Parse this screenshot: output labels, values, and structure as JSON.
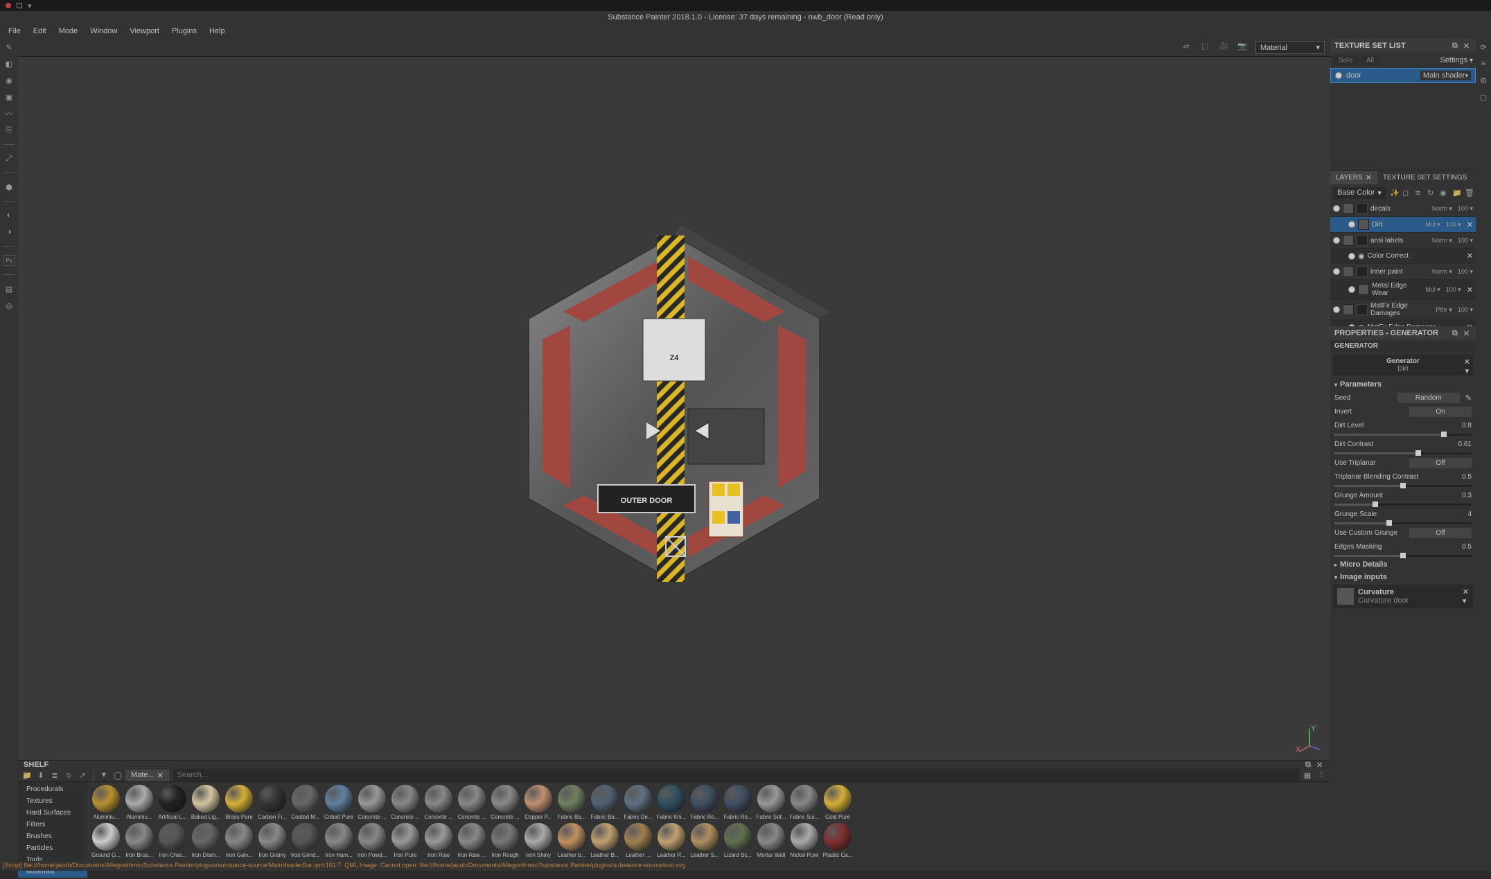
{
  "window": {
    "title": "Substance Painter 2018.1.0 - License: 37 days remaining - nwb_door (Read only)"
  },
  "menu": [
    "File",
    "Edit",
    "Mode",
    "Window",
    "Viewport",
    "Plugins",
    "Help"
  ],
  "viewport": {
    "material_dropdown": "Material",
    "model_label_top": "Z4",
    "model_label_bottom": "OUTER DOOR"
  },
  "texture_set": {
    "title": "TEXTURE SET LIST",
    "solo": "Solo",
    "all": "All",
    "settings": "Settings",
    "item": "door",
    "shader": "Main shader"
  },
  "layers_panel": {
    "tabs": [
      "LAYERS",
      "TEXTURE SET SETTINGS"
    ],
    "channel": "Base Color",
    "layers": [
      {
        "name": "decals",
        "blend": "Norm",
        "opacity": "100"
      },
      {
        "name": "Dirt",
        "blend": "Mul",
        "opacity": "100",
        "sub": true,
        "selected": true
      },
      {
        "name": "ansi labels",
        "blend": "Norm",
        "opacity": "100"
      },
      {
        "name": "Color Correct",
        "sub": true,
        "fx": true
      },
      {
        "name": "inner paint",
        "blend": "Norm",
        "opacity": "100"
      },
      {
        "name": "Metal Edge Wear",
        "blend": "Mul",
        "opacity": "100",
        "sub": true
      },
      {
        "name": "MatFx Edge Damages",
        "blend": "Pthr",
        "opacity": "100"
      },
      {
        "name": "MatFx Edge Damages",
        "sub": true,
        "fx": true
      }
    ]
  },
  "properties": {
    "title": "PROPERTIES - GENERATOR",
    "section": "GENERATOR",
    "gen_label": "Generator",
    "gen_name": "Dirt",
    "params_title": "Parameters",
    "params": [
      {
        "label": "Seed",
        "btn": "Random"
      },
      {
        "label": "Invert",
        "btn": "On"
      },
      {
        "label": "Dirt Level",
        "val": "0.8",
        "slider": 80
      },
      {
        "label": "Dirt Contrast",
        "val": "0.61",
        "slider": 61
      },
      {
        "label": "Use Triplanar",
        "btn": "Off"
      },
      {
        "label": "Triplanar Blending Contrast",
        "val": "0.5",
        "slider": 50
      },
      {
        "label": "Grunge Amount",
        "val": "0.3",
        "slider": 30
      },
      {
        "label": "Grunge Scale",
        "val": "4",
        "slider": 40
      },
      {
        "label": "Use Custom Grunge",
        "btn": "Off"
      },
      {
        "label": "Edges Masking",
        "val": "0.5",
        "slider": 50
      }
    ],
    "micro": "Micro Details",
    "image_inputs": "Image inputs",
    "curvature": "Curvature",
    "curvature_src": "Curvature door"
  },
  "shelf": {
    "title": "SHELF",
    "tab_label": "Mate...",
    "search_placeholder": "Search...",
    "categories": [
      "Procedurals",
      "Textures",
      "Hard Surfaces",
      "Filters",
      "Brushes",
      "Particles",
      "Tools",
      "Materials"
    ],
    "active_cat": "Materials",
    "row1": [
      "Aluminiu...",
      "Aluminiu...",
      "Artificial L...",
      "Baked Lig...",
      "Brass Pure",
      "Carbon Fi...",
      "Coated M...",
      "Cobalt Pure",
      "Concrete ...",
      "Concrete ...",
      "Concrete ...",
      "Concrete ...",
      "Concrete ...",
      "Copper P...",
      "Fabric Ba...",
      "Fabric Ba...",
      "Fabric De...",
      "Fabric Kni...",
      "Fabric Ro...",
      "Fabric Ro...",
      "Fabric Sof...",
      "Fabric Sui...",
      "Gold Pure"
    ],
    "row2": [
      "Ground G...",
      "Iron Brus...",
      "Iron Chai...",
      "Iron Diam...",
      "Iron Galv...",
      "Iron Grainy",
      "Iron Grind...",
      "Iron Ham...",
      "Iron Powd...",
      "Iron Pure",
      "Iron Raw",
      "Iron Raw ...",
      "Iron Rough",
      "Iron Shiny",
      "Leather b...",
      "Leather B...",
      "Leather ...",
      "Leather R...",
      "Leather S...",
      "Lizard Sc...",
      "Mortar Wall",
      "Nickel Pure",
      "Plastic Ca..."
    ],
    "colors1": [
      "#b89030",
      "#aaa",
      "#222",
      "#d4c4a0",
      "#d4af37",
      "#333",
      "#666",
      "#6080a0",
      "#999",
      "#888",
      "#888",
      "#888",
      "#888",
      "#c09070",
      "#708060",
      "#506070",
      "#607080",
      "#305060",
      "#405060",
      "#405060",
      "#999",
      "#888",
      "#d4af37"
    ],
    "colors2": [
      "#ccc",
      "#888",
      "#555",
      "#666",
      "#888",
      "#888",
      "#555",
      "#888",
      "#888",
      "#999",
      "#999",
      "#888",
      "#777",
      "#aaa",
      "#c09060",
      "#c0a070",
      "#a08050",
      "#c0a070",
      "#b09060",
      "#607050",
      "#888",
      "#aaa",
      "#803030"
    ]
  },
  "status": "[Script] file:///home/jacob/Documents/Allegorithmic/Substance Painter/plugins/substance-source/MainHeaderBar.qml:161:7: QML Image: Cannot open: file:///home/jacob/Documents/Allegorithmic/Substance Painter/plugins/substance-source/exit.svg"
}
